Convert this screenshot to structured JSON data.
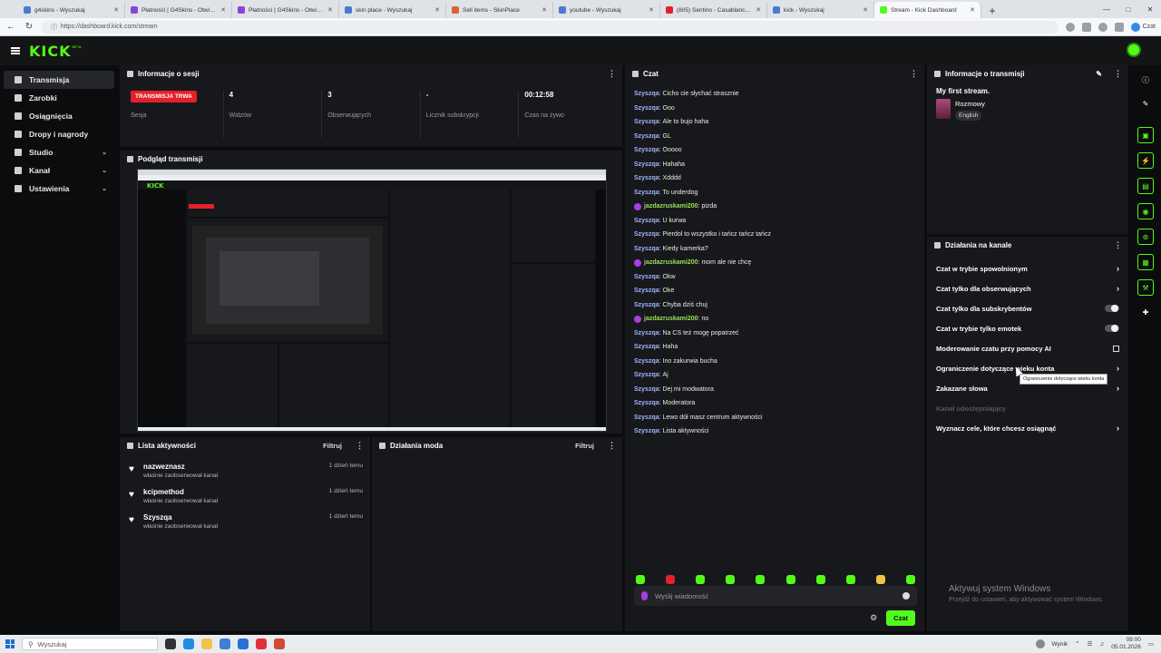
{
  "browser": {
    "tabs": [
      {
        "title": "g4skins - Wyszukaj",
        "color": "#4a7bd0",
        "active": false
      },
      {
        "title": "Płatności | G4Skins - Otwieraj skrz...",
        "color": "#8a45d6",
        "active": false
      },
      {
        "title": "Płatności | G4Skins - Otwieraj skrz...",
        "color": "#8a45d6",
        "active": false
      },
      {
        "title": "skin place - Wyszukaj",
        "color": "#4a7bd0",
        "active": false
      },
      {
        "title": "Sell items - SkinPlace",
        "color": "#e0603a",
        "active": false
      },
      {
        "title": "youtube - Wyszukaj",
        "color": "#4a7bd0",
        "active": false
      },
      {
        "title": "(805) Sentino - Casablanca (p...",
        "color": "#e5202b",
        "active": false
      },
      {
        "title": "kick - Wyszukaj",
        "color": "#4a7bd0",
        "active": false
      },
      {
        "title": "Stream - Kick Dashboard",
        "color": "#53fc18",
        "active": true
      }
    ],
    "url": "https://dashboard.kick.com/stream",
    "chat_label": "Czat"
  },
  "kick": {
    "logo": "KICK",
    "logo_sup": "BETA"
  },
  "sidebar": {
    "items": [
      {
        "label": "Transmisja",
        "icon": "broadcast-icon",
        "active": true,
        "chevron": false
      },
      {
        "label": "Zarobki",
        "icon": "earnings-icon",
        "active": false,
        "chevron": false
      },
      {
        "label": "Osiągnięcia",
        "icon": "trophy-icon",
        "active": false,
        "chevron": false
      },
      {
        "label": "Dropy i nagrody",
        "icon": "gift-icon",
        "active": false,
        "chevron": false
      },
      {
        "label": "Studio",
        "icon": "studio-icon",
        "active": false,
        "chevron": true
      },
      {
        "label": "Kanał",
        "icon": "channel-icon",
        "active": false,
        "chevron": true
      },
      {
        "label": "Ustawienia",
        "icon": "gear-icon",
        "active": false,
        "chevron": true
      }
    ]
  },
  "session": {
    "title": "Informacje o sesji",
    "status_badge": "TRANSMISJA TRWA",
    "status_label": "Sesja",
    "viewers_value": "4",
    "viewers_label": "Widzów",
    "followers_value": "3",
    "followers_label": "Obserwujących",
    "subs_value": "-",
    "subs_label": "Licznik subskrypcji",
    "time_value": "00:12:58",
    "time_label": "Czas na żywo"
  },
  "preview": {
    "title": "Podgląd transmisji"
  },
  "activity": {
    "title": "Lista aktywności",
    "filter": "Filtruj",
    "items": [
      {
        "name": "nazweznasz",
        "sub": "właśnie zaobserwował kanał",
        "time": "1 dzień temu"
      },
      {
        "name": "kcipmethod",
        "sub": "właśnie zaobserwował kanał",
        "time": "1 dzień temu"
      },
      {
        "name": "Szyszqa",
        "sub": "właśnie zaobserwował kanał",
        "time": "1 dzień temu"
      }
    ]
  },
  "mod": {
    "title": "Działania moda",
    "filter": "Filtruj"
  },
  "chat": {
    "title": "Czat",
    "messages": [
      {
        "user": "Szyszqa",
        "text": "Cicho cie słychać strasznie",
        "special": false
      },
      {
        "user": "Szyszqa",
        "text": "Ooo",
        "special": false
      },
      {
        "user": "Szyszqa",
        "text": "Ale to bujo haha",
        "special": false
      },
      {
        "user": "Szyszqa",
        "text": "GL",
        "special": false
      },
      {
        "user": "Szyszqa",
        "text": "Ooooo",
        "special": false
      },
      {
        "user": "Szyszqa",
        "text": "Hahaha",
        "special": false
      },
      {
        "user": "Szyszqa",
        "text": "Xdddd",
        "special": false
      },
      {
        "user": "Szyszqa",
        "text": "To underdog",
        "special": false
      },
      {
        "user": "jazdazruskami200",
        "text": "pizda",
        "special": true
      },
      {
        "user": "Szyszqa",
        "text": "U kurwa",
        "special": false
      },
      {
        "user": "Szyszqa",
        "text": "Pierdol to wszystko i tańcz tańcz tańcz",
        "special": false
      },
      {
        "user": "Szyszqa",
        "text": "Kiedy kamerka?",
        "special": false
      },
      {
        "user": "jazdazruskami200",
        "text": "mom ale nie chcę",
        "special": true
      },
      {
        "user": "Szyszqa",
        "text": "Okw",
        "special": false
      },
      {
        "user": "Szyszqa",
        "text": "Oke",
        "special": false
      },
      {
        "user": "Szyszqa",
        "text": "Chyba dziś chuj",
        "special": false
      },
      {
        "user": "jazdazruskami200",
        "text": "no",
        "special": true
      },
      {
        "user": "Szyszqa",
        "text": "Na CS też mogę popatrzeć",
        "special": false
      },
      {
        "user": "Szyszqa",
        "text": "Haha",
        "special": false
      },
      {
        "user": "Szyszqa",
        "text": "Ino zakurwia bucha",
        "special": false
      },
      {
        "user": "Szyszqa",
        "text": "Aj",
        "special": false
      },
      {
        "user": "Szyszqa",
        "text": "Dej mi modwatora",
        "special": false
      },
      {
        "user": "Szyszqa",
        "text": "Moderatora",
        "special": false
      },
      {
        "user": "Szyszqa",
        "text": "Lewo dół masz centrum aktywności",
        "special": false
      },
      {
        "user": "Szyszqa",
        "text": "Lista aktywności",
        "special": false
      }
    ],
    "input_placeholder": "Wyślij wiadomość",
    "send_label": "Czat"
  },
  "stream_info": {
    "title": "Informacje o transmisji",
    "stream_title": "My first stream.",
    "category": "Rozmowy",
    "language": "English"
  },
  "channel_actions": {
    "title": "Działania na kanale",
    "items": [
      {
        "label": "Czat w trybie spowolnionym",
        "control": "chevron"
      },
      {
        "label": "Czat tylko dla obserwujących",
        "control": "chevron"
      },
      {
        "label": "Czat tylko dla subskrybentów",
        "control": "toggle"
      },
      {
        "label": "Czat w trybie tylko emotek",
        "control": "toggle"
      },
      {
        "label": "Moderowanie czatu przy pomocy AI",
        "control": "external"
      },
      {
        "label": "Ograniczenie dotyczące wieku konta",
        "control": "chevron"
      },
      {
        "label": "Zakazane słowa",
        "control": "chevron"
      },
      {
        "label": "Kanał udostępniający",
        "control": "disabled"
      },
      {
        "label": "Wyznacz cele, które chcesz osiągnąć",
        "control": "chevron"
      }
    ],
    "tooltip": "Ograniczenie dotyczące wieku konta"
  },
  "watermark": {
    "line1": "Aktywuj system Windows",
    "line2": "Przejdź do ustawień, aby aktywować system Windows."
  },
  "taskbar": {
    "search_placeholder": "Wyszukaj",
    "weather": "Wynik",
    "time": "09:00",
    "date": "05.01.2026"
  },
  "colors": {
    "kick_green": "#53fc18",
    "live_red": "#e5202b",
    "username_blue": "#9fb4ff",
    "username_green": "#9be05a"
  }
}
